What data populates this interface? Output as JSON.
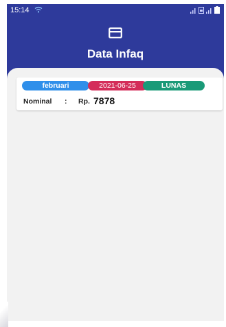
{
  "status_bar": {
    "time": "15:14",
    "icons": [
      "wifi-icon",
      "signal-icon",
      "sim-icon",
      "battery-icon"
    ]
  },
  "header": {
    "icon": "card-icon",
    "title": "Data Infaq"
  },
  "records": [
    {
      "month": "februari",
      "date": "2021-06-25",
      "status": "LUNAS",
      "nominal_label": "Nominal",
      "separator": ":",
      "currency": "Rp.",
      "amount": "7878"
    }
  ],
  "colors": {
    "primary": "#2e3a9b",
    "background": "#f2f2f2",
    "badge_month": "#2f8fea",
    "badge_date": "#d42d5a",
    "badge_status": "#1a9a78"
  }
}
